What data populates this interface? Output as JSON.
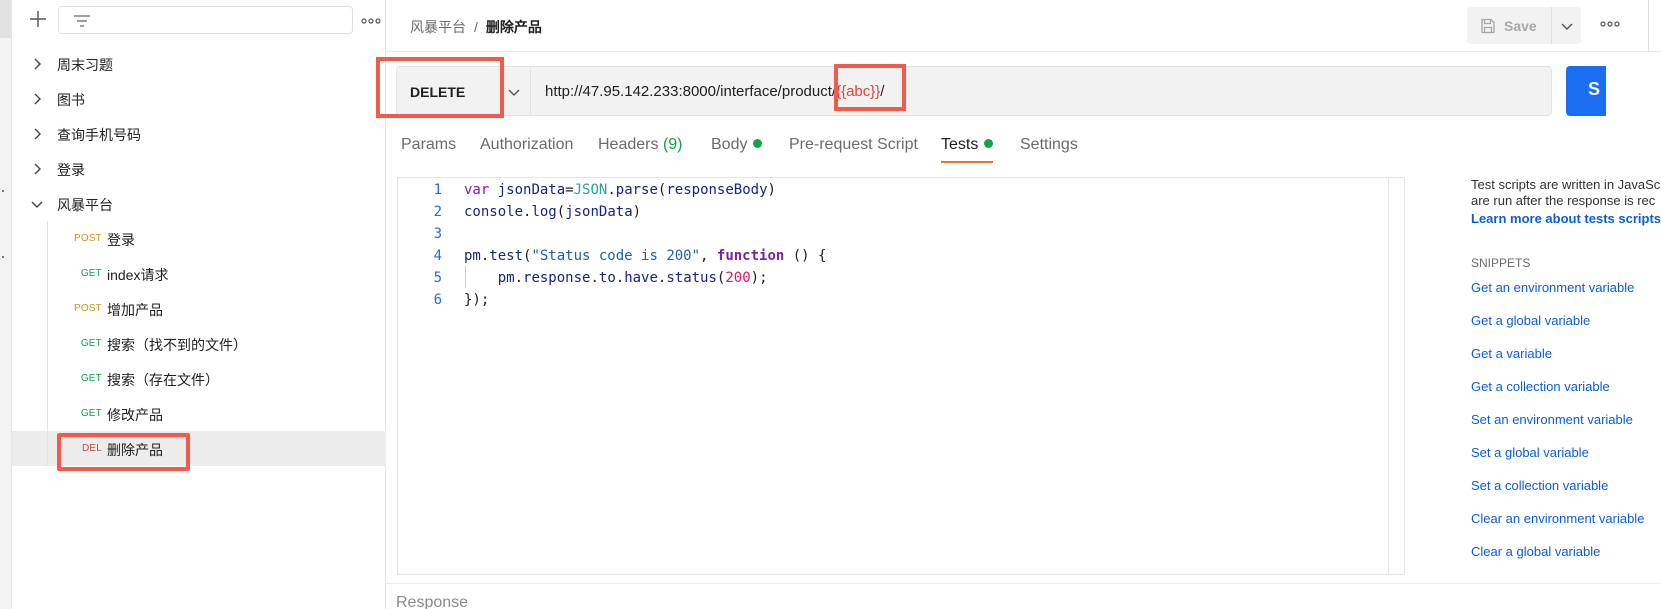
{
  "sidebar": {
    "folders_top": [
      {
        "label": "周末习题"
      },
      {
        "label": "图书"
      },
      {
        "label": "查询手机号码"
      },
      {
        "label": "登录"
      }
    ],
    "open_folder": {
      "label": "风暴平台"
    },
    "requests": [
      {
        "method": "POST",
        "name": "登录"
      },
      {
        "method": "GET",
        "name": "index请求"
      },
      {
        "method": "POST",
        "name": "增加产品"
      },
      {
        "method": "GET",
        "name": "搜索（找不到的文件）"
      },
      {
        "method": "GET",
        "name": "搜索（存在文件）"
      },
      {
        "method": "GET",
        "name": "修改产品"
      },
      {
        "method": "DEL",
        "name": "删除产品"
      }
    ]
  },
  "header": {
    "breadcrumb_parent": "风暴平台",
    "breadcrumb_sep": "/",
    "breadcrumb_current": "删除产品",
    "save_label": "Save"
  },
  "request": {
    "method": "DELETE",
    "url_prefix": "http://47.95.142.233:8000/interface/product/",
    "url_variable": "{{abc}}",
    "url_suffix": "/",
    "send_label": "S"
  },
  "tabs": [
    {
      "label": "Params"
    },
    {
      "label": "Authorization"
    },
    {
      "label": "Headers",
      "count": "(9)"
    },
    {
      "label": "Body",
      "dot": true
    },
    {
      "label": "Pre-request Script"
    },
    {
      "label": "Tests",
      "dot": true,
      "active": true
    },
    {
      "label": "Settings"
    }
  ],
  "editor": {
    "line_numbers": [
      "1",
      "2",
      "3",
      "4",
      "5",
      "6"
    ]
  },
  "help": {
    "line1": "Test scripts are written in JavaSc",
    "line2": "are run after the response is rec",
    "learn_more": "Learn more about tests scripts",
    "snippets_heading": "SNIPPETS",
    "snippets": [
      "Get an environment variable",
      "Get a global variable",
      "Get a variable",
      "Get a collection variable",
      "Set an environment variable",
      "Set a global variable",
      "Set a collection variable",
      "Clear an environment variable",
      "Clear a global variable"
    ]
  },
  "response": {
    "label": "Response"
  },
  "colors": {
    "post": "#c9961a",
    "get": "#10a14c",
    "delete": "#d14848",
    "annotation": "#f05b4c",
    "accent": "#f26b3a",
    "send": "#1a6ef2"
  }
}
